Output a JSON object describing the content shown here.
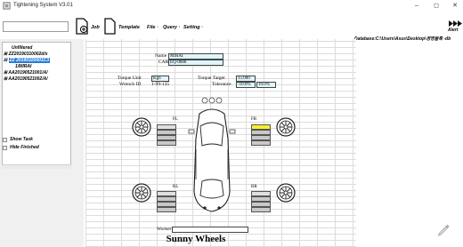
{
  "window": {
    "title": "Tightening System V3.01",
    "minimize_glyph": "–",
    "maximize_glyph": "◻",
    "close_glyph": "✕"
  },
  "toolbar": {
    "job_label": "Job",
    "template_label": "Template",
    "file_menu": "File ·",
    "query_menu": "Query ·",
    "setting_menu": "Setting ·",
    "alert_label": "Alert"
  },
  "tree": {
    "items": [
      {
        "label": "Unfiltered"
      },
      {
        "label": "ZZ20190310002d/x"
      },
      {
        "label": "ZZ 20190320001C3"
      },
      {
        "label": "1/MIRAI"
      },
      {
        "label": "AA20190521001/A/"
      },
      {
        "label": "AA20190521002/A/"
      }
    ]
  },
  "options": {
    "show_task": "Show Task",
    "hide_finished": "Hide Finished"
  },
  "path": "Database:C:\\Users\\Asus\\Desktop\\경영블록 -db",
  "sheet": {
    "name_label": "Name",
    "name_value": "MIRAI",
    "car_label": "CAR",
    "car_value": "EQ-0888",
    "torque_unit_label": "Torque Unit",
    "torque_unit_value": "Kgn",
    "torque_target_label": "Torque Target",
    "torque_target_value": "15.000",
    "wrench_id_label": "Wrench ID",
    "wrench_id_value": "1-99-135",
    "tolerance_label": "Tolerance",
    "tolerance_minus": "-10.0%",
    "tolerance_plus": "10.0%",
    "fl": "FL",
    "fr": "FR",
    "rl": "RL",
    "rr": "RR",
    "worker_label": "Worker",
    "worker_value": "",
    "brand": "Sunny Wheels"
  },
  "colors": {
    "tree_selected": "#2c7bd6",
    "input_cell": "#dff5fb",
    "active_bar": "#f7ef2a"
  },
  "icons": {
    "job": "new-document-icon",
    "template": "document-icon",
    "alert": "fast-forward-icon",
    "pen": "pen-icon"
  }
}
